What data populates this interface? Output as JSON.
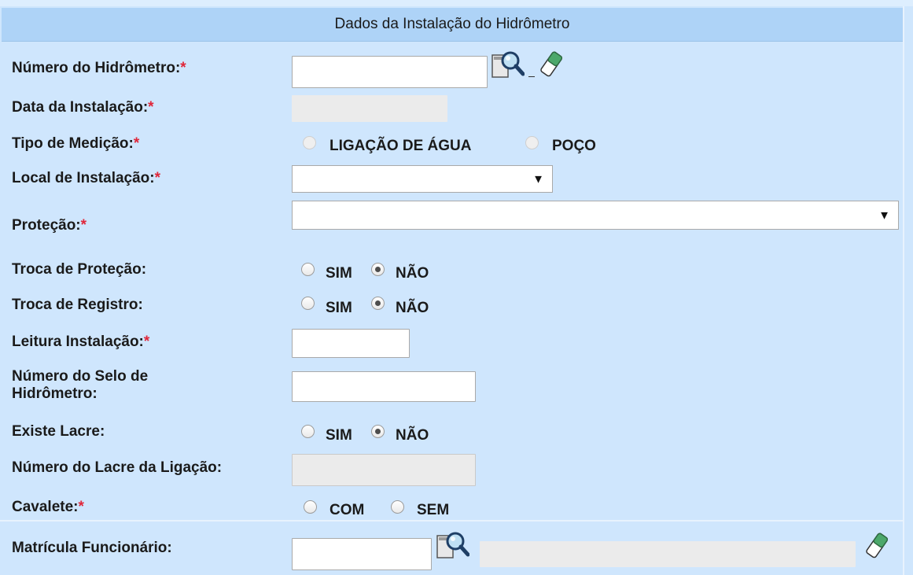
{
  "header": {
    "title": "Dados da Instalação do Hidrômetro"
  },
  "form": {
    "numero_hidrometro": {
      "label": "Número do Hidrômetro:",
      "required": "*",
      "value": ""
    },
    "data_instalacao": {
      "label": "Data da Instalação:",
      "required": "*",
      "value": ""
    },
    "tipo_medicao": {
      "label": "Tipo de Medição:",
      "required": "*",
      "options": [
        "LIGAÇÃO DE ÁGUA",
        "POÇO"
      ]
    },
    "local_instalacao": {
      "label": "Local de Instalação:",
      "required": "*",
      "value": ""
    },
    "protecao": {
      "label": "Proteção:",
      "required": "*",
      "value": ""
    },
    "troca_protecao": {
      "label": "Troca de Proteção:",
      "options": [
        "SIM",
        "NÃO"
      ],
      "selected": "NÃO"
    },
    "troca_registro": {
      "label": "Troca de Registro:",
      "options": [
        "SIM",
        "NÃO"
      ],
      "selected": "NÃO"
    },
    "leitura_instalacao": {
      "label": "Leitura Instalação:",
      "required": "*",
      "value": ""
    },
    "numero_selo": {
      "label_line1": "Número do Selo de",
      "label_line2": "Hidrômetro:",
      "value": ""
    },
    "existe_lacre": {
      "label": "Existe Lacre:",
      "options": [
        "SIM",
        "NÃO"
      ],
      "selected": "NÃO"
    },
    "numero_lacre": {
      "label": "Número do Lacre da Ligação:",
      "value": ""
    },
    "cavalete": {
      "label": "Cavalete:",
      "required": "*",
      "options": [
        "COM",
        "SEM"
      ]
    },
    "matricula": {
      "label": "Matrícula Funcionário:",
      "value": "",
      "name_value": ""
    }
  },
  "icons": [
    "search-icon",
    "eraser-icon"
  ],
  "colors": {
    "background": "#cfe6fd",
    "header": "#aed3f7",
    "required": "#e0273a"
  }
}
